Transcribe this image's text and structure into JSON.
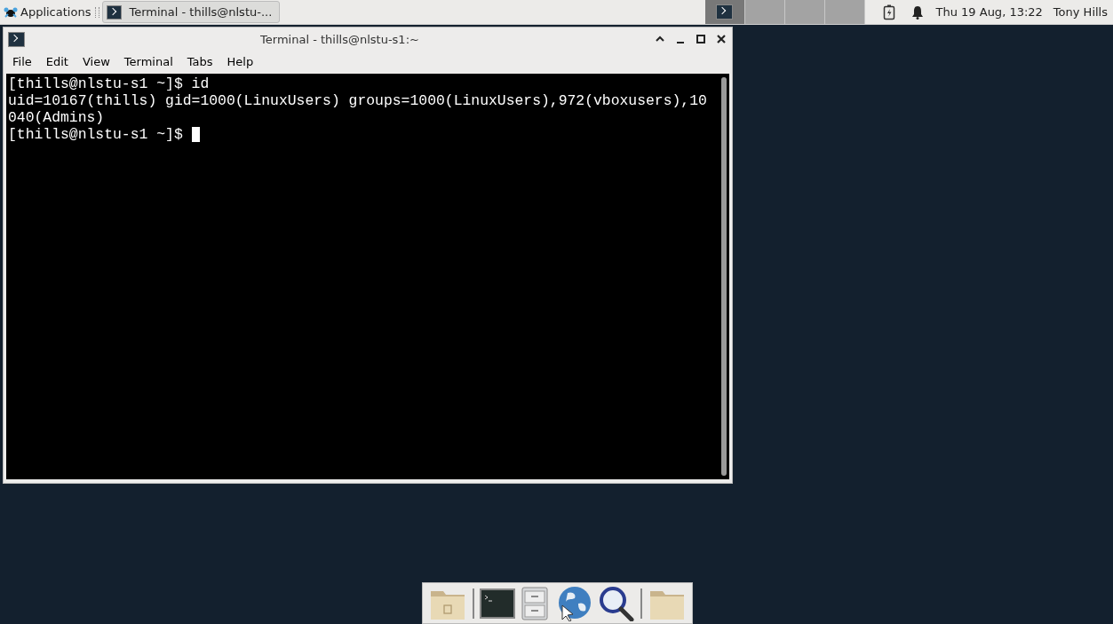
{
  "panel": {
    "applications_label": "Applications",
    "tasks": [
      {
        "title": "Terminal - thills@nlstu-...",
        "selected": true
      }
    ],
    "workspaces": [
      {
        "selected": true
      },
      {
        "selected": false
      },
      {
        "selected": false
      },
      {
        "selected": false
      }
    ],
    "clock": "Thu 19 Aug, 13:22",
    "user": "Tony Hills"
  },
  "window": {
    "title": "Terminal - thills@nlstu-s1:~",
    "menu": [
      "File",
      "Edit",
      "View",
      "Terminal",
      "Tabs",
      "Help"
    ],
    "terminal_lines": [
      "[thills@nlstu-s1 ~]$ id",
      "uid=10167(thills) gid=1000(LinuxUsers) groups=1000(LinuxUsers),972(vboxusers),10",
      "040(Admins)",
      "[thills@nlstu-s1 ~]$ "
    ]
  },
  "dock": [
    {
      "kind": "home-folder"
    },
    {
      "kind": "separator"
    },
    {
      "kind": "terminal"
    },
    {
      "kind": "cabinet"
    },
    {
      "kind": "globe"
    },
    {
      "kind": "search"
    },
    {
      "kind": "separator"
    },
    {
      "kind": "folder"
    }
  ]
}
